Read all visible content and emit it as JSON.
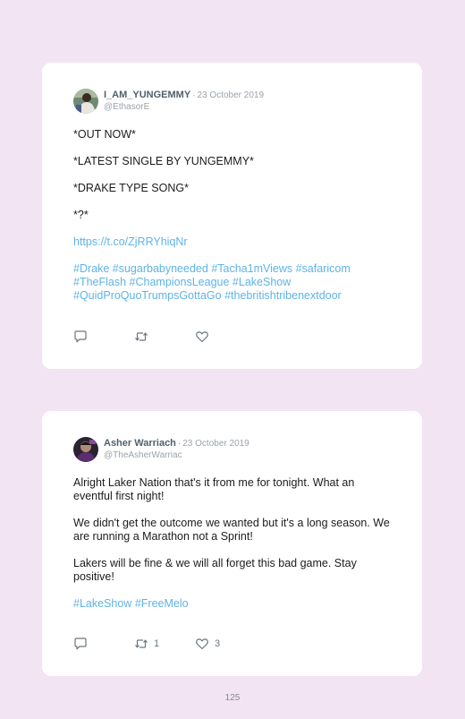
{
  "tweets": [
    {
      "display_name": "I_AM_YUNGEMMY",
      "separator": "·",
      "date": "23 October 2019",
      "handle": "@EthasorE",
      "paragraphs": [
        "*OUT NOW*",
        "*LATEST SINGLE BY YUNGEMMY*",
        "*DRAKE TYPE SONG*",
        "*?*"
      ],
      "link": "https://t.co/ZjRRYhiqNr",
      "hashtags": [
        "#Drake",
        "#sugarbabyneeded",
        "#Tacha1mViews",
        "#safaricom",
        "#TheFlash",
        "#ChampionsLeague",
        "#LakeShow",
        "#QuidProQuoTrumpsGottaGo",
        "#thebritishtribenextdoor"
      ],
      "retweets": "",
      "likes": ""
    },
    {
      "display_name": "Asher Warriach",
      "separator": "·",
      "date": "23 October 2019",
      "handle": "@TheAsherWarriac",
      "paragraphs": [
        "Alright Laker Nation that's it from me for tonight. What an eventful first night!",
        "We didn't get the outcome we wanted but it's a long season. We are running a Marathon not a Sprint!",
        "Lakers will be fine & we will all forget this bad game. Stay positive!"
      ],
      "hashtags": [
        "#LakeShow",
        "#FreeMelo"
      ],
      "retweets": "1",
      "likes": "3"
    }
  ],
  "page_number": "125",
  "colors": {
    "background": "#f2e4f3",
    "card": "#ffffff",
    "link": "#5fb3e6",
    "muted": "#9aa3ab",
    "name": "#52606d"
  },
  "icons": {
    "reply": "speech-bubble-icon",
    "retweet": "retweet-arrows-icon",
    "like": "heart-icon"
  }
}
